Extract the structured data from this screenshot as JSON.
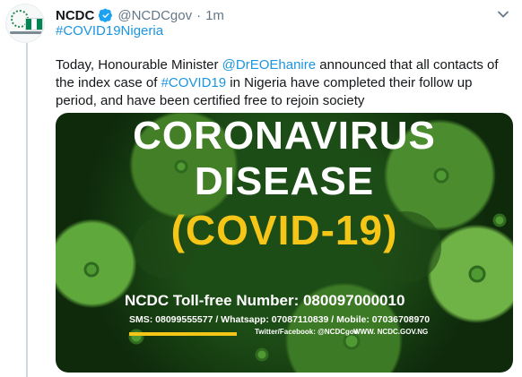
{
  "tweet": {
    "author_name": "NCDC",
    "handle": "@NCDCgov",
    "separator": "·",
    "time": "1m",
    "hashtag": "#COVID19Nigeria",
    "text_1": "Today, Honourable Minister ",
    "mention": "@DrEOEhanire",
    "text_2": " announced that all contacts of the index case of ",
    "hashtag_inline": "#COVID19",
    "text_3": " in Nigeria have completed their follow up period, and have been certified free to rejoin society"
  },
  "media": {
    "line_1": "CORONAVIRUS",
    "line_2": "DISEASE",
    "line_3": "(COVID-19)",
    "tollfree": "NCDC Toll-free Number: 080097000010",
    "contacts": "SMS: 08099555577 / Whatsapp: 07087110839 / Mobile: 07036708970",
    "social": "Twitter/Facebook: @NCDCgov",
    "website": "WWW. NCDC.GOV.NG"
  },
  "icons": {
    "verified": "verified-badge-icon",
    "caret": "chevron-down-icon"
  },
  "colors": {
    "link": "#1b95e0",
    "verified": "#1da1f2",
    "media_accent": "#f5c518"
  }
}
